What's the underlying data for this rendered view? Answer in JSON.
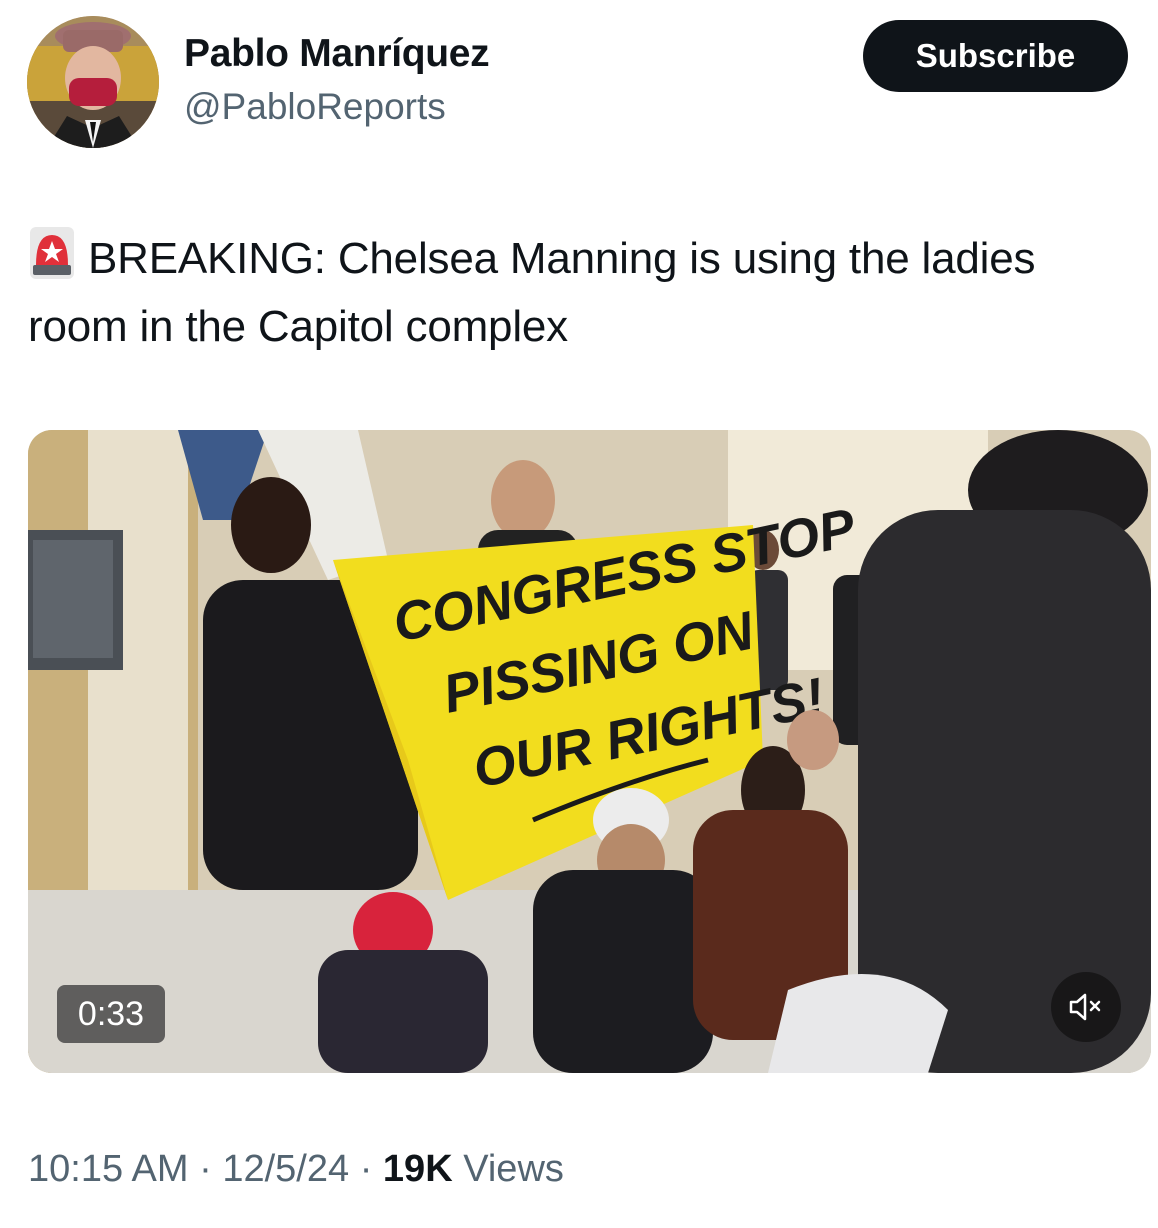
{
  "author": {
    "name": "Pablo Manríquez",
    "handle": "@PabloReports"
  },
  "actions": {
    "subscribe_label": "Subscribe"
  },
  "tweet": {
    "emoji_icon": "police-siren-icon",
    "text": "BREAKING: Chelsea Manning is using the ladies room in the Capitol complex"
  },
  "media": {
    "banner_text": [
      "CONGRESS STOP",
      "PISSING ON",
      "OUR RIGHTS!"
    ],
    "duration": "0:33",
    "mute_icon": "speaker-muted-icon"
  },
  "meta": {
    "time": "10:15 AM",
    "separator": "·",
    "date": "12/5/24",
    "views_count": "19K",
    "views_label": "Views"
  },
  "colors": {
    "text_primary": "#0f1419",
    "text_secondary": "#536471",
    "button_bg": "#0f1419",
    "button_text": "#ffffff",
    "banner_yellow": "#f2dd1e"
  }
}
